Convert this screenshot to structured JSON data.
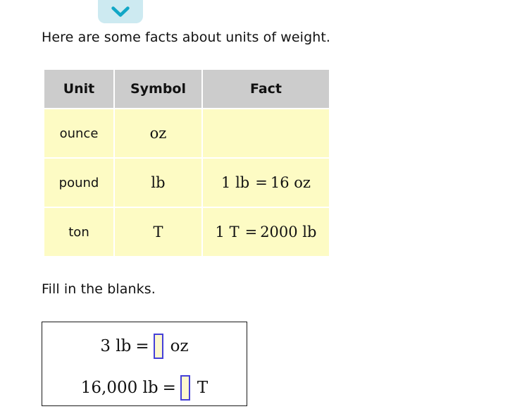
{
  "toolbar": {
    "collapse_button_name": "chevron-down-icon",
    "chevron_color": "#12a7c6",
    "button_bg": "#cdeaf1"
  },
  "intro": {
    "text": "Here are some facts about units of weight."
  },
  "facts_table": {
    "headers": [
      "Unit",
      "Symbol",
      "Fact"
    ],
    "header_bg": "#cccccc",
    "cell_bg": "#fdfbc4",
    "rows": [
      {
        "unit": "ounce",
        "symbol": "oz",
        "fact": ""
      },
      {
        "unit": "pound",
        "symbol": "lb",
        "fact_left": "1 lb",
        "fact_eq": "=",
        "fact_right": "16 oz"
      },
      {
        "unit": "ton",
        "symbol": "T",
        "fact_left": "1 T",
        "fact_eq": "=",
        "fact_right": "2000 lb"
      }
    ]
  },
  "prompt": {
    "text": "Fill in the blanks."
  },
  "answers": {
    "border_color": "#1a1a1a",
    "input_border_color": "#4540d8",
    "input_bg": "#fcf7cf",
    "rows": [
      {
        "lead": "3 lb",
        "eq": "=",
        "value": "",
        "placeholder": "",
        "unit": "oz"
      },
      {
        "lead": "16,000 lb",
        "eq": "=",
        "value": "",
        "placeholder": "",
        "unit": "T"
      }
    ]
  }
}
